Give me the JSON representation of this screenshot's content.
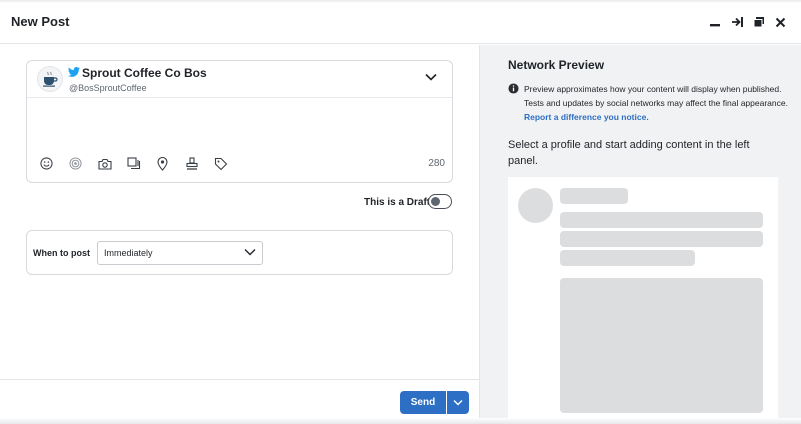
{
  "header": {
    "title": "New Post"
  },
  "compose": {
    "profile_name": "Sprout Coffee Co Bos",
    "profile_handle": "@BosSproutCoffee",
    "text_value": "",
    "char_count": "280"
  },
  "draft": {
    "label": "This is a Draft",
    "enabled": false
  },
  "schedule": {
    "label": "When to post",
    "selected": "Immediately"
  },
  "footer": {
    "send_label": "Send"
  },
  "preview": {
    "title": "Network Preview",
    "note": "Preview approximates how your content will display when published. Tests and updates by social networks may affect the final appearance.",
    "link": "Report a difference you notice.",
    "instruction": "Select a profile and start adding content in the left panel."
  },
  "icons": {
    "window_controls": [
      "minimize-icon",
      "collapse-right-icon",
      "copy-window-icon",
      "close-icon"
    ],
    "toolbar": [
      "emoji-icon",
      "target-icon",
      "camera-icon",
      "media-library-icon",
      "location-icon",
      "stamp-icon",
      "tag-icon"
    ]
  },
  "colors": {
    "accent": "#2d6fc4",
    "twitter": "#1da1f2",
    "preview_bg": "#f1f2f3",
    "skeleton": "#dcdddf"
  }
}
